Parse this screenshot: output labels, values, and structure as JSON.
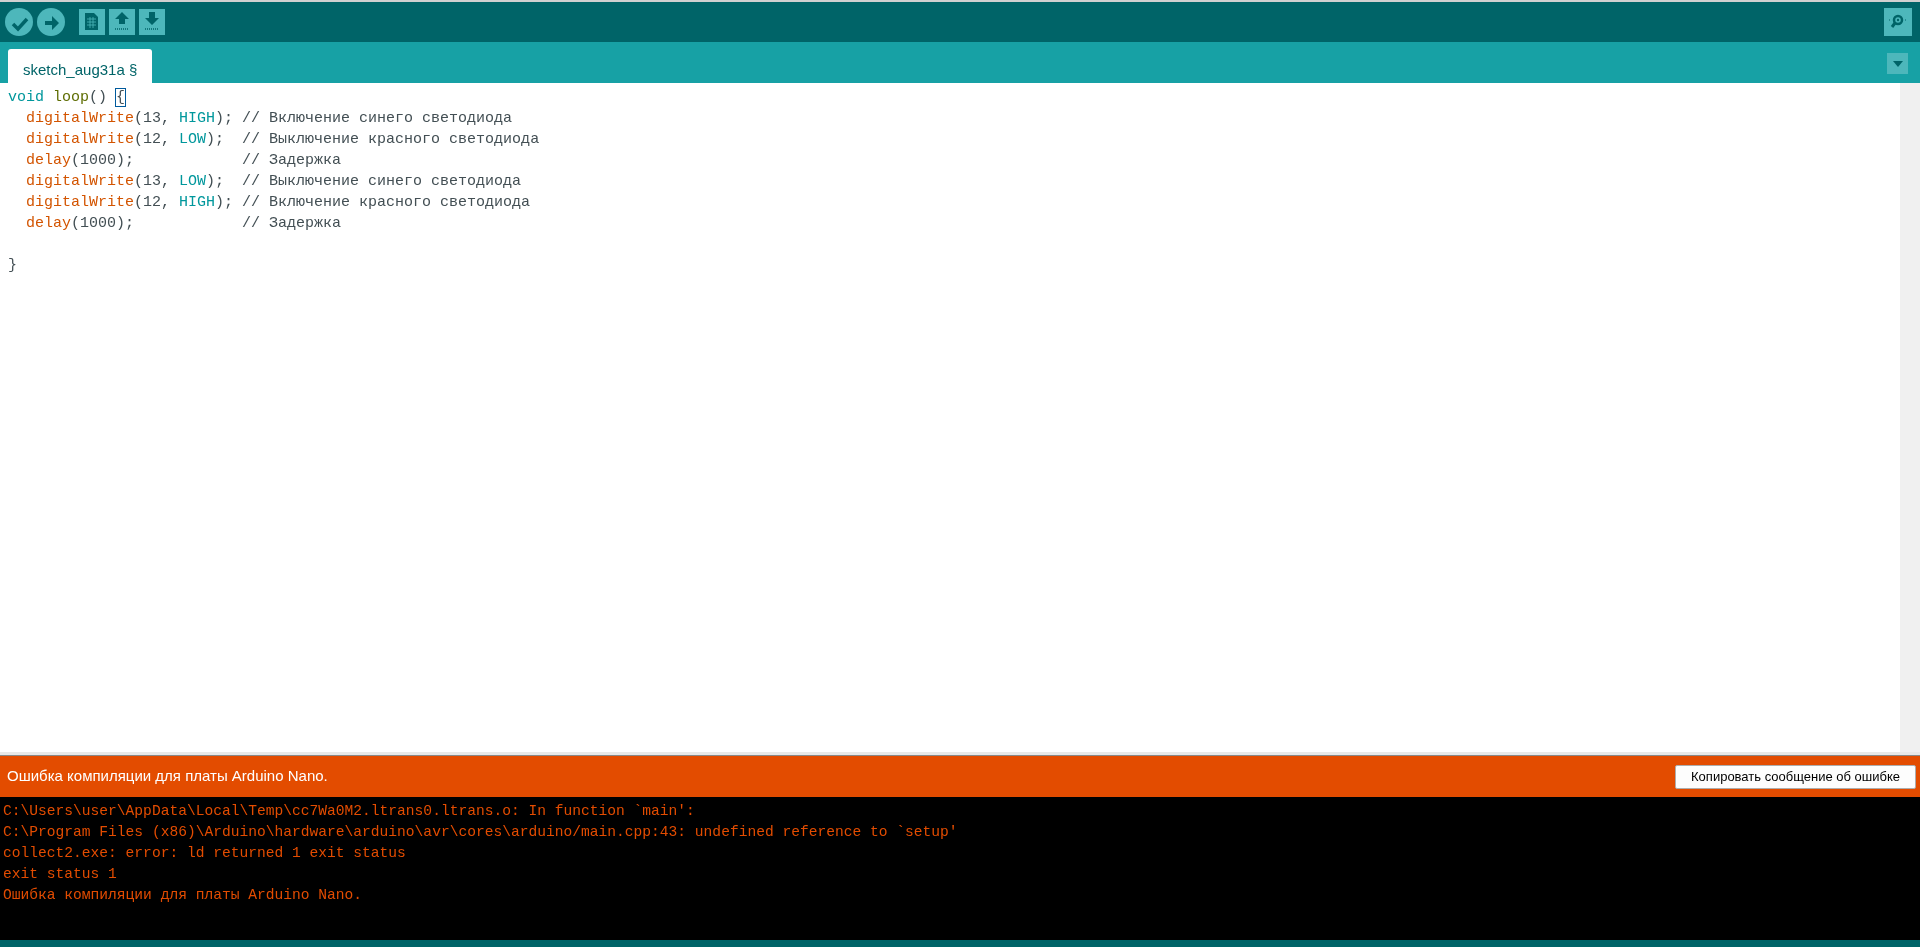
{
  "toolbar": {
    "buttons": [
      {
        "kind": "verify"
      },
      {
        "kind": "upload"
      },
      {
        "kind": "new"
      },
      {
        "kind": "open"
      },
      {
        "kind": "save"
      }
    ]
  },
  "tabs": [
    {
      "label": "sketch_aug31a §",
      "selected": true
    }
  ],
  "editor": {
    "lines": [
      {
        "kind": "code",
        "tokens": [
          {
            "kind": "keyword",
            "text": "void "
          },
          {
            "kind": "name",
            "text": "loop"
          },
          {
            "kind": "plain",
            "text": "() "
          },
          {
            "kind": "bracket",
            "text": "{"
          }
        ],
        "children": [
          {
            "kind": "code",
            "tokens": [
              {
                "kind": "function",
                "text": "digitalWrite"
              },
              {
                "kind": "plain",
                "text": "(13, "
              },
              {
                "kind": "constant",
                "text": "HIGH"
              },
              {
                "kind": "plain",
                "text": "); "
              },
              {
                "kind": "comment",
                "text": "// Включение синего светодиода"
              }
            ]
          },
          {
            "kind": "code",
            "tokens": [
              {
                "kind": "function",
                "text": "digitalWrite"
              },
              {
                "kind": "plain",
                "text": "(12, "
              },
              {
                "kind": "constant",
                "text": "LOW"
              },
              {
                "kind": "plain",
                "text": ");  "
              },
              {
                "kind": "comment",
                "text": "// Выключение красного светодиода"
              }
            ]
          },
          {
            "kind": "code",
            "tokens": [
              {
                "kind": "function",
                "text": "delay"
              },
              {
                "kind": "plain",
                "text": "(1000);            "
              },
              {
                "kind": "comment",
                "text": "// Задержка"
              }
            ]
          },
          {
            "kind": "code",
            "tokens": [
              {
                "kind": "function",
                "text": "digitalWrite"
              },
              {
                "kind": "plain",
                "text": "(13, "
              },
              {
                "kind": "constant",
                "text": "LOW"
              },
              {
                "kind": "plain",
                "text": ");  "
              },
              {
                "kind": "comment",
                "text": "// Выключение синего светодиода"
              }
            ]
          },
          {
            "kind": "code",
            "tokens": [
              {
                "kind": "function",
                "text": "digitalWrite"
              },
              {
                "kind": "plain",
                "text": "(12, "
              },
              {
                "kind": "constant",
                "text": "HIGH"
              },
              {
                "kind": "plain",
                "text": "); "
              },
              {
                "kind": "comment",
                "text": "// Включение красного светодиода"
              }
            ]
          },
          {
            "kind": "code",
            "tokens": [
              {
                "kind": "function",
                "text": "delay"
              },
              {
                "kind": "plain",
                "text": "(1000);            "
              },
              {
                "kind": "comment",
                "text": "// Задержка"
              }
            ]
          }
        ]
      },
      {
        "kind": "blank"
      },
      {
        "kind": "code",
        "tokens": [
          {
            "kind": "plain",
            "text": "}"
          }
        ]
      }
    ]
  },
  "status_bar": {
    "message": "Ошибка компиляции для платы Arduino Nano.",
    "button": "Копировать сообщение об ошибке"
  },
  "console": {
    "lines": [
      "C:\\Users\\user\\AppData\\Local\\Temp\\cc7Wa0M2.ltrans0.ltrans.o: In function `main':",
      "C:\\Program Files (x86)\\Arduino\\hardware\\arduino\\avr\\cores\\arduino/main.cpp:43: undefined reference to `setup'",
      "collect2.exe: error: ld returned 1 exit status",
      "exit status 1",
      "Ошибка компиляции для платы Arduino Nano."
    ]
  }
}
